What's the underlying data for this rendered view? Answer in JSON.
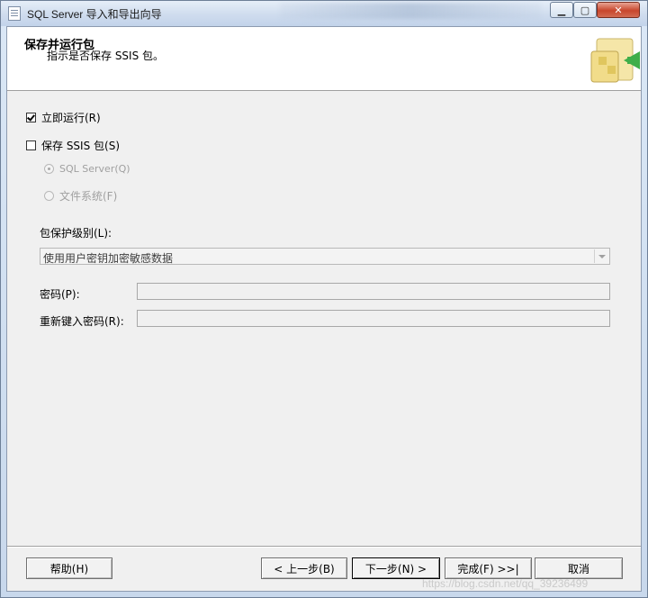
{
  "window": {
    "title": "SQL Server 导入和导出向导"
  },
  "header": {
    "title": "保存并运行包",
    "description": "指示是否保存 SSIS 包。"
  },
  "options": {
    "run_immediately": {
      "label": "立即运行(R)",
      "checked": true
    },
    "save_ssis": {
      "label": "保存 SSIS 包(S)",
      "checked": false
    },
    "sql_server": {
      "label": "SQL Server(Q)",
      "selected": true,
      "enabled": false
    },
    "file_system": {
      "label": "文件系统(F)",
      "selected": false,
      "enabled": false
    }
  },
  "protection": {
    "label": "包保护级别(L):",
    "value": "使用用户密钥加密敏感数据"
  },
  "password": {
    "label": "密码(P):",
    "value": ""
  },
  "retype_password": {
    "label": "重新键入密码(R):",
    "value": ""
  },
  "buttons": {
    "help": "帮助(H)",
    "back": "< 上一步(B)",
    "next": "下一步(N) >",
    "finish": "完成(F) >>|",
    "cancel": "取消"
  },
  "watermark": "https://blog.csdn.net/qq_39236499"
}
